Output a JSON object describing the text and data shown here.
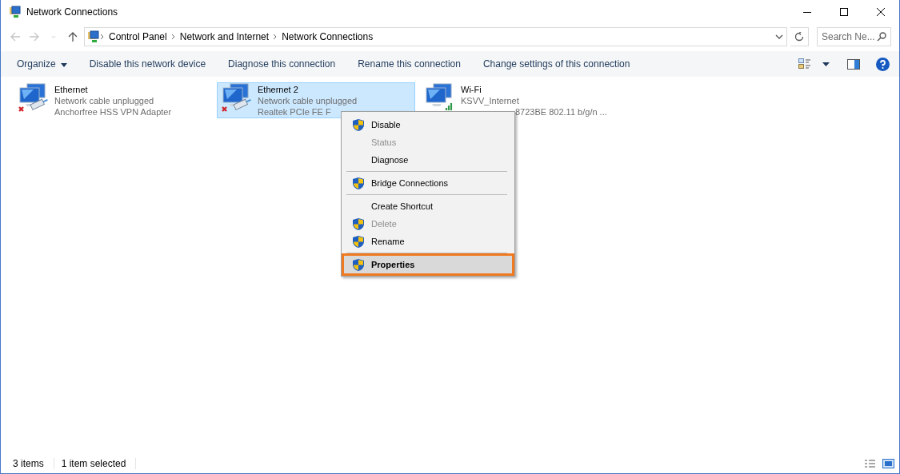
{
  "window": {
    "title": "Network Connections"
  },
  "address": {
    "crumbs": [
      "Control Panel",
      "Network and Internet",
      "Network Connections"
    ]
  },
  "search": {
    "placeholder": "Search Ne..."
  },
  "toolbar": {
    "items": [
      {
        "label": "Organize",
        "kind": "dropdown"
      },
      {
        "label": "Disable this network device",
        "kind": "command"
      },
      {
        "label": "Diagnose this connection",
        "kind": "command"
      },
      {
        "label": "Rename this connection",
        "kind": "command"
      },
      {
        "label": "Change settings of this connection",
        "kind": "command"
      }
    ]
  },
  "connections": [
    {
      "name": "Ethernet",
      "status": "Network cable unplugged",
      "adapter": "Anchorfree HSS VPN Adapter",
      "kind": "wired",
      "selected": false
    },
    {
      "name": "Ethernet 2",
      "status": "Network cable unplugged",
      "adapter": "Realtek PCIe FE F",
      "kind": "wired",
      "selected": true
    },
    {
      "name": "Wi-Fi",
      "status": "KSVV_Internet",
      "adapter": "8723BE 802.11 b/g/n ...",
      "kind": "wireless",
      "selected": false
    }
  ],
  "context_menu": {
    "items": [
      {
        "label": "Disable",
        "shield": true,
        "disabled": false,
        "selected": false
      },
      {
        "label": "Status",
        "shield": false,
        "disabled": true,
        "selected": false
      },
      {
        "label": "Diagnose",
        "shield": false,
        "disabled": false,
        "selected": false
      },
      {
        "kind": "separator"
      },
      {
        "label": "Bridge Connections",
        "shield": true,
        "disabled": false,
        "selected": false
      },
      {
        "kind": "separator"
      },
      {
        "label": "Create Shortcut",
        "shield": false,
        "disabled": false,
        "selected": false
      },
      {
        "label": "Delete",
        "shield": true,
        "disabled": true,
        "selected": false
      },
      {
        "label": "Rename",
        "shield": true,
        "disabled": false,
        "selected": false
      },
      {
        "kind": "separator"
      },
      {
        "label": "Properties",
        "shield": true,
        "disabled": false,
        "selected": true
      }
    ]
  },
  "status_bar": {
    "count": "3 items",
    "selection": "1 item selected"
  }
}
